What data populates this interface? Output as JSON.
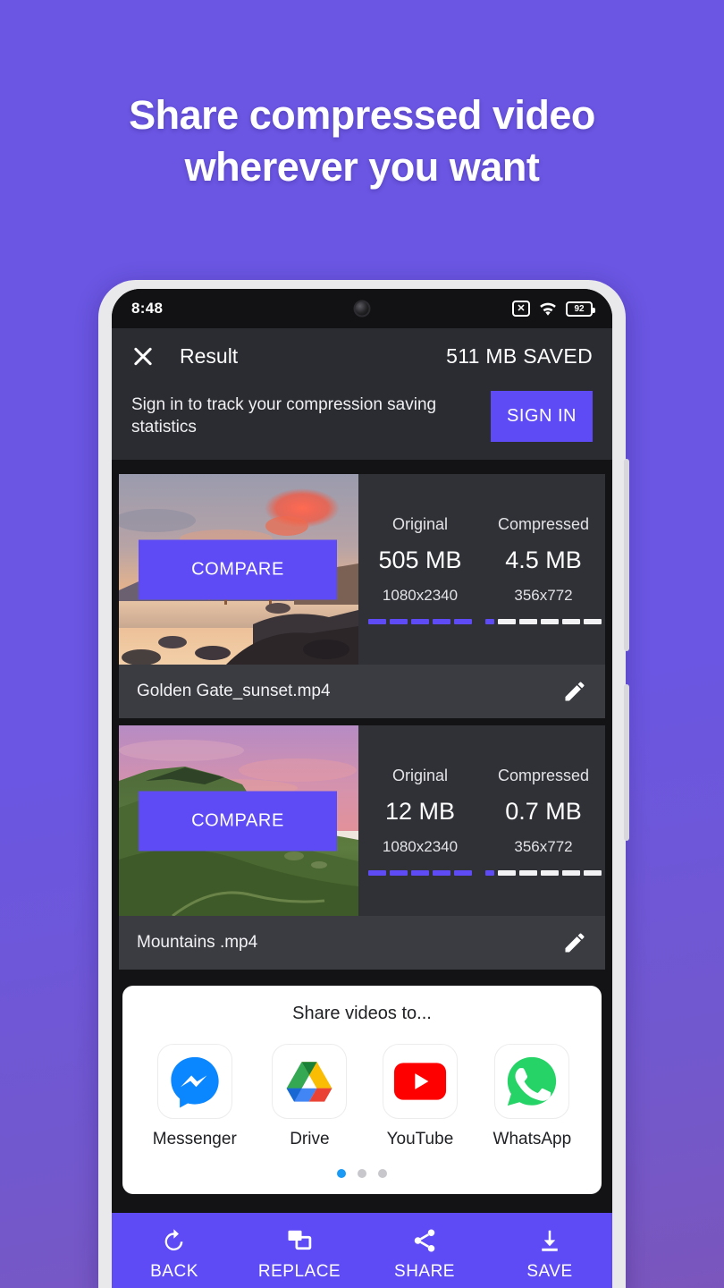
{
  "promo": {
    "headline_line1": "Share compressed video",
    "headline_line2": "wherever you want",
    "background_color": "#6a56e2"
  },
  "status_bar": {
    "time": "8:48",
    "sim_icon": "no-sim-icon",
    "sim_glyph": "✕",
    "wifi_icon": "wifi-icon",
    "battery_icon": "battery-icon",
    "battery_level": "92"
  },
  "app_bar": {
    "close_icon": "close-icon",
    "title": "Result",
    "saved_label": "511 MB SAVED",
    "background_color": "#2a2c31"
  },
  "sign_in_banner": {
    "message": "Sign in to track your compression saving statistics",
    "button_label": "SIGN IN",
    "button_color": "#5e4bf5"
  },
  "results": [
    {
      "compare_label": "COMPARE",
      "thumbnail": "golden-gate-sunset-thumbnail",
      "original": {
        "label": "Original",
        "size": "505 MB",
        "dimensions": "1080x2340"
      },
      "compressed": {
        "label": "Compressed",
        "size": "4.5 MB",
        "dimensions": "356x772"
      },
      "filename": "Golden Gate_sunset.mp4",
      "edit_icon": "pencil-icon"
    },
    {
      "compare_label": "COMPARE",
      "thumbnail": "mountains-thumbnail",
      "original": {
        "label": "Original",
        "size": "12 MB",
        "dimensions": "1080x2340"
      },
      "compressed": {
        "label": "Compressed",
        "size": "0.7 MB",
        "dimensions": "356x772"
      },
      "filename": "Mountains .mp4",
      "edit_icon": "pencil-icon"
    }
  ],
  "share_sheet": {
    "title": "Share videos to...",
    "apps": [
      {
        "label": "Messenger",
        "icon": "messenger-icon"
      },
      {
        "label": "Drive",
        "icon": "google-drive-icon"
      },
      {
        "label": "YouTube",
        "icon": "youtube-icon"
      },
      {
        "label": "WhatsApp",
        "icon": "whatsapp-icon"
      }
    ],
    "page_dots": 3,
    "active_dot": 0,
    "active_dot_color": "#1a9af5"
  },
  "bottom_bar": {
    "background_color": "#5e4bf5",
    "actions": [
      {
        "label": "BACK",
        "icon": "undo-icon"
      },
      {
        "label": "REPLACE",
        "icon": "replace-icon"
      },
      {
        "label": "SHARE",
        "icon": "share-icon"
      },
      {
        "label": "SAVE",
        "icon": "download-icon"
      }
    ]
  }
}
